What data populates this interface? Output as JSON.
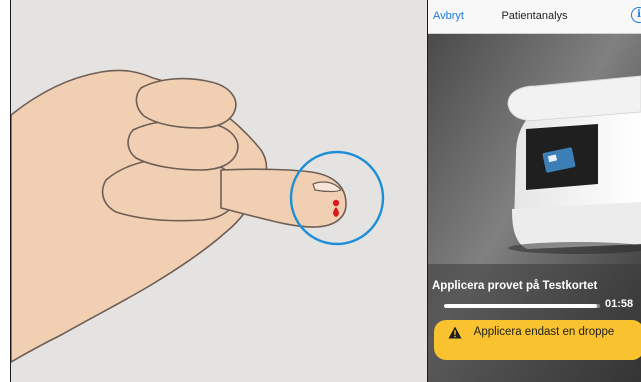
{
  "nav": {
    "cancel_label": "Avbryt",
    "title": "Patientanalys",
    "info_icon": "info-circle-icon"
  },
  "instruction": "Applicera provet på Testkortet",
  "timer": {
    "text": "01:58",
    "remaining_fraction": 0.98
  },
  "warning": {
    "icon": "warning-triangle-icon",
    "text": "Applicera endast en droppe"
  },
  "colors": {
    "accent": "#1a7ae0",
    "warning_bg": "#f9c32f",
    "target_circle": "#1e8fd6",
    "blood": "#d71b1b"
  }
}
